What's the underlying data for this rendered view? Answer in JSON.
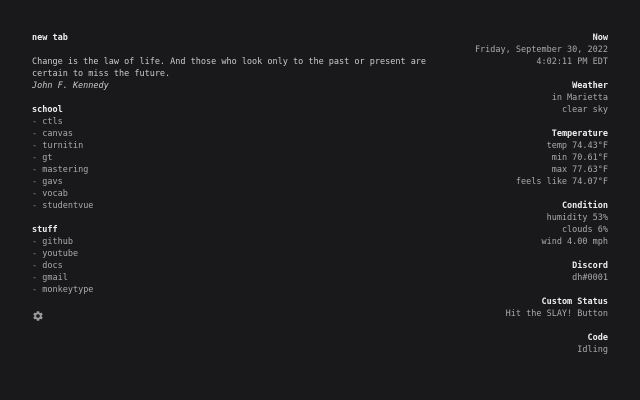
{
  "header": {
    "title": "new tab"
  },
  "quote": {
    "text": "Change is the law of life. And those who look only to the past or present are certain to miss the future.",
    "author": "John F. Kennedy"
  },
  "groups": [
    {
      "title": "school",
      "links": [
        "ctls",
        "canvas",
        "turnitin",
        "gt",
        "mastering",
        "gavs",
        "vocab",
        "studentvue"
      ]
    },
    {
      "title": "stuff",
      "links": [
        "github",
        "youtube",
        "docs",
        "gmail",
        "monkeytype"
      ]
    }
  ],
  "icons": {
    "settings": "gear-icon"
  },
  "panel": {
    "now": {
      "title": "Now",
      "date": "Friday, September 30, 2022",
      "time": "4:02:11 PM EDT"
    },
    "weather": {
      "title": "Weather",
      "location": "in Marietta",
      "description": "clear sky"
    },
    "temperature": {
      "title": "Temperature",
      "temp": "temp 74.43°F",
      "min": "min 70.61°F",
      "max": "max 77.63°F",
      "feels": "feels like 74.07°F"
    },
    "condition": {
      "title": "Condition",
      "humidity": "humidity 53%",
      "clouds": "clouds 6%",
      "wind": "wind 4.00 mph"
    },
    "discord": {
      "title": "Discord",
      "user": "dh#0001"
    },
    "status": {
      "title": "Custom Status",
      "text": "Hit the SLAY! Button"
    },
    "code": {
      "title": "Code",
      "state": "Idling"
    }
  },
  "colors": {
    "background": "#19191c",
    "text": "#d4d4d6",
    "muted": "#a9a9ad"
  }
}
